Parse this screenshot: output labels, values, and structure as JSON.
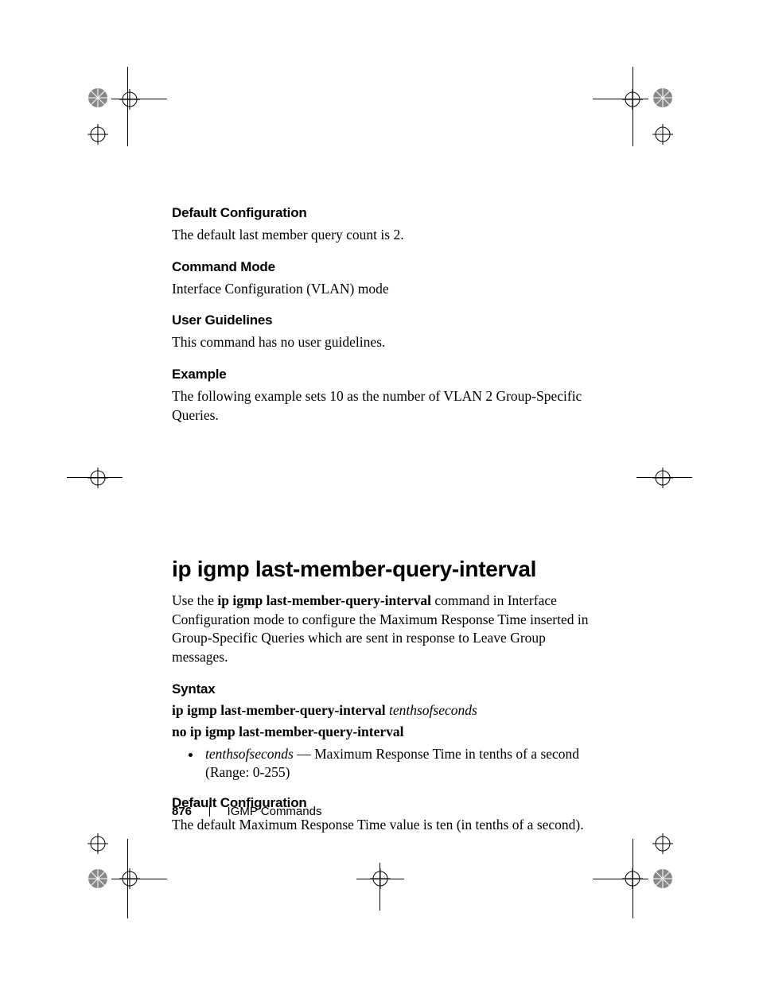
{
  "sections": {
    "defcfg1": {
      "heading": "Default Configuration",
      "text": "The default last member query count is 2."
    },
    "cmdmode": {
      "heading": "Command Mode",
      "text": "Interface Configuration (VLAN) mode"
    },
    "userguide": {
      "heading": "User Guidelines",
      "text": "This command has no user guidelines."
    },
    "example": {
      "heading": "Example",
      "text": "The following example sets 10 as the number of VLAN 2 Group-Specific Queries."
    }
  },
  "command": {
    "title": "ip igmp last-member-query-interval",
    "desc_pre": "Use the ",
    "desc_bold": "ip igmp last-member-query-interval",
    "desc_post": " command in Interface Configuration mode to configure the Maximum Response Time inserted in Group-Specific Queries which are sent in response to Leave Group messages."
  },
  "syntax": {
    "heading": "Syntax",
    "line1_bold": "ip igmp last-member-query-interval",
    "line1_ital": "tenthsofseconds",
    "line2_bold": "no ip igmp last-member-query-interval",
    "bullet_ital": "tenthsofseconds",
    "bullet_rest": " — Maximum Response Time in tenths of a second (Range: 0-255)"
  },
  "defcfg2": {
    "heading": "Default Configuration",
    "text": "The default Maximum Response Time value is ten (in tenths of a second)."
  },
  "footer": {
    "page": "876",
    "section": "IGMP Commands"
  }
}
